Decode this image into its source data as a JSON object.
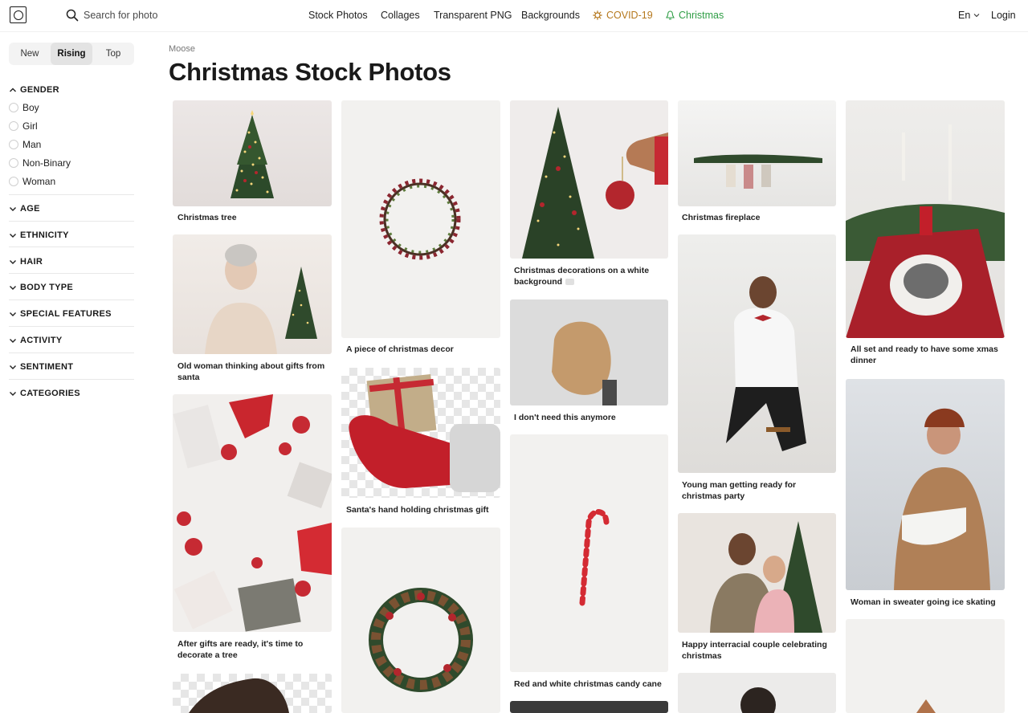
{
  "header": {
    "search_placeholder": "Search for photo",
    "nav": [
      "Stock Photos",
      "Collages",
      "Transparent PNG",
      "Backgrounds"
    ],
    "covid_label": "COVID-19",
    "christmas_label": "Christmas",
    "lang": "En",
    "login": "Login"
  },
  "sort": {
    "options": [
      "New",
      "Rising",
      "Top"
    ],
    "active": "Rising"
  },
  "filters": {
    "gender": {
      "title": "GENDER",
      "options": [
        "Boy",
        "Girl",
        "Man",
        "Non-Binary",
        "Woman"
      ]
    },
    "age": "AGE",
    "ethnicity": "ETHNICITY",
    "hair": "HAIR",
    "body_type": "BODY TYPE",
    "special_features": "SPECIAL FEATURES",
    "activity": "ACTIVITY",
    "sentiment": "SENTIMENT",
    "categories": "CATEGORIES"
  },
  "breadcrumb": "Moose",
  "page_title": "Christmas Stock Photos",
  "photos": [
    "Christmas tree",
    "Old woman thinking about gifts from santa",
    "After gifts are ready, it's time to decorate a tree",
    "A piece of christmas decor",
    "Santa's hand holding christmas gift",
    "Christmas decorations on a white background",
    "I don't need this anymore",
    "Red and white christmas candy cane",
    "Christmas fireplace",
    "Young man getting ready for christmas party",
    "Happy interracial couple celebrating christmas",
    "All set and ready to have some xmas dinner",
    "Woman in sweater going ice skating"
  ],
  "colors": {
    "covid": "#b5781d",
    "christmas": "#2e9d45",
    "accent_red": "#b3262d"
  }
}
